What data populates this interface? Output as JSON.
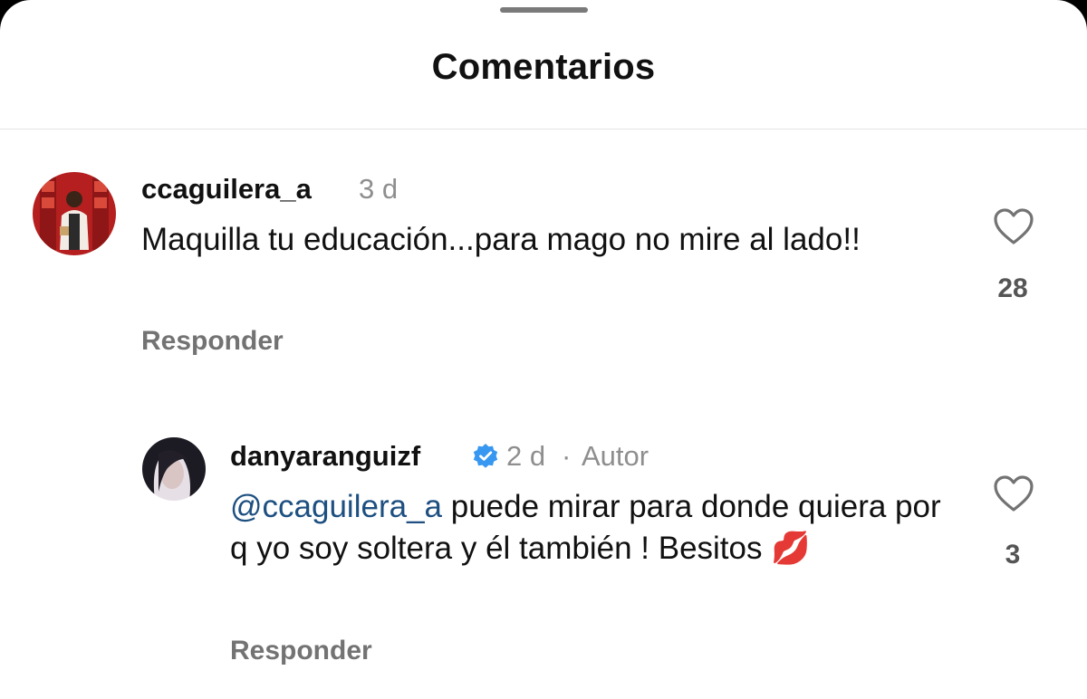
{
  "sheet": {
    "title": "Comentarios"
  },
  "comments": [
    {
      "username": "ccaguilera_a",
      "time": "3 d",
      "text": "Maquilla  tu educación...para mago no mire al lado!!",
      "reply_label": "Responder",
      "likes": "28",
      "icon": "heart-outline-icon"
    }
  ],
  "reply": {
    "username": "danyaranguizf",
    "verified_icon": "verified-badge-icon",
    "time": "2 d",
    "separator": "·",
    "author_tag": "Autor",
    "mention": "@ccaguilera_a",
    "text": " puede mirar para donde quiera por q yo soy soltera y él también ! Besitos 💋",
    "reply_label": "Responder",
    "likes": "3",
    "icon": "heart-outline-icon"
  },
  "colors": {
    "mention": "#1d4f80",
    "verified": "#3897f0",
    "secondary_text": "#8e8e8e"
  }
}
